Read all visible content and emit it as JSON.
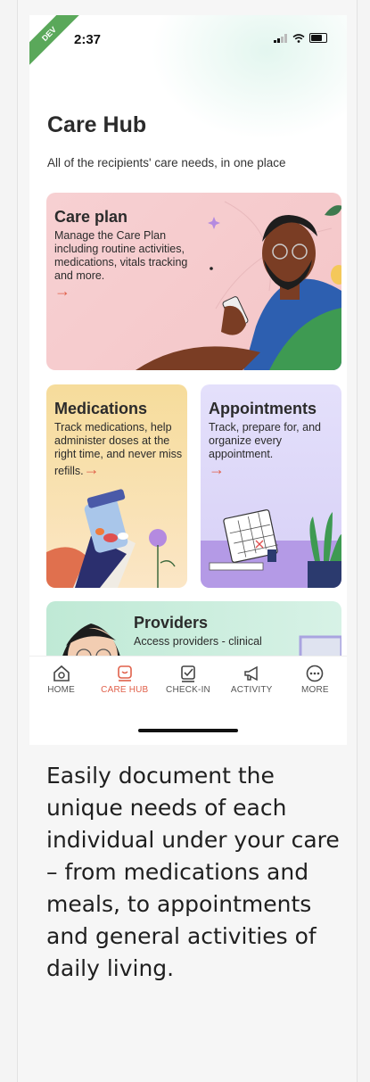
{
  "status_bar": {
    "time": "2:37",
    "build_tag": "DEV"
  },
  "page": {
    "title": "Care Hub",
    "subtitle": "All of the recipients' care needs, in one place"
  },
  "cards": {
    "care_plan": {
      "title": "Care plan",
      "description": "Manage the Care Plan including routine activities, medications, vitals tracking and more."
    },
    "medications": {
      "title": "Medications",
      "description": "Track medications, help administer doses at the right time, and never miss refills."
    },
    "appointments": {
      "title": "Appointments",
      "description": "Track, prepare for, and organize every appointment."
    },
    "providers": {
      "title": "Providers",
      "description": "Access providers - clinical"
    }
  },
  "tabbar": {
    "home": "HOME",
    "care_hub": "CARE HUB",
    "check_in": "CHECK-IN",
    "activity": "ACTIVITY",
    "more": "MORE",
    "active": "care_hub",
    "accent_color": "#e0604a"
  },
  "caption": "Easily document the unique needs of each individual under your care – from medications and meals, to appointments and general activities of daily living."
}
